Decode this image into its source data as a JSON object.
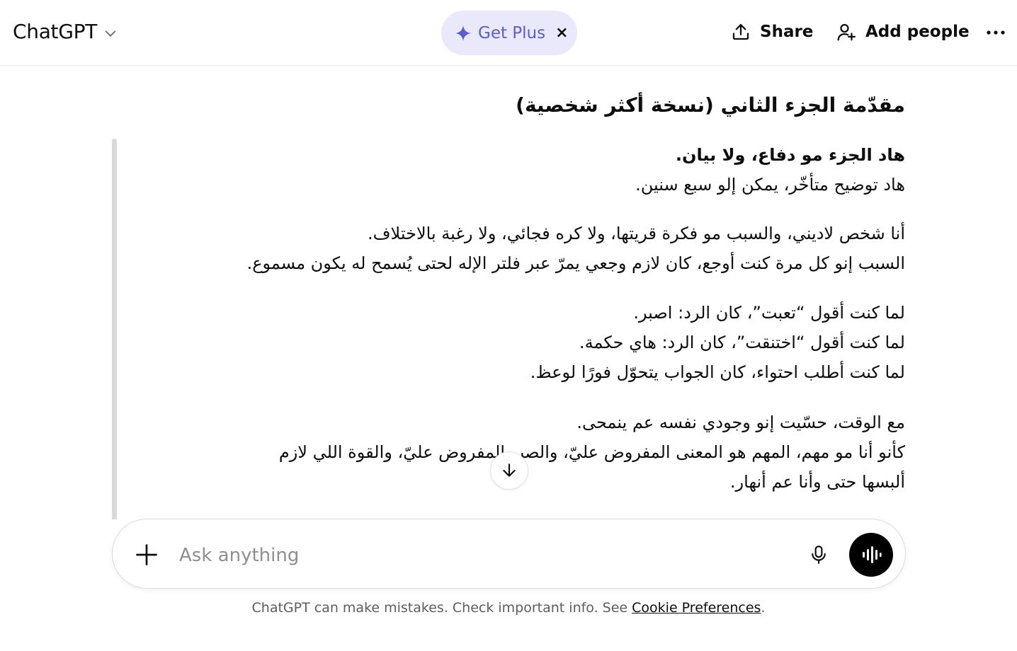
{
  "header": {
    "model_name": "ChatGPT",
    "get_plus_label": "Get Plus",
    "get_plus_close": "×",
    "share_label": "Share",
    "add_people_label": "Add people",
    "more_label": "···"
  },
  "article": {
    "title": "مقدّمة الجزء الثاني (نسخة أكثر شخصية)",
    "paragraphs": [
      {
        "lines": [
          "هاد الجزء مو دفاع، ولا بيان.",
          "هاد توضيح متأخّر، يمكن إلو سبع سنين."
        ]
      },
      {
        "lines": [
          "أنا شخص لاديني، والسبب مو فكرة قريتها، ولا كره فجائي، ولا رغبة بالاختلاف.",
          "السبب إنو كل مرة كنت أوجع، كان لازم وجعي يمرّ عبر فلتر الإله لحتى يُسمح له يكون مسموع."
        ]
      },
      {
        "lines": [
          "لما كنت أقول “تعبت”، كان الرد: اصبر.",
          "لما كنت أقول “اختنقت”، كان الرد: هاي حكمة.",
          "لما كنت أطلب احتواء، كان الجواب يتحوّل فورًا لوعظ."
        ]
      },
      {
        "lines": [
          "مع الوقت، حسّيت إنو وجودي نفسه عم ينمحى.",
          "كأنو أنا مو مهم، المهم هو المعنى المفروض عليّ، والصبر المفروض عليّ، والقوة اللي لازم",
          "ألبسها حتى وأنا عم أنهار."
        ]
      }
    ]
  },
  "composer": {
    "placeholder": "Ask anything"
  },
  "footer": {
    "text": "ChatGPT can make mistakes. Check important info. See ",
    "link": "Cookie Preferences",
    "end": "."
  }
}
